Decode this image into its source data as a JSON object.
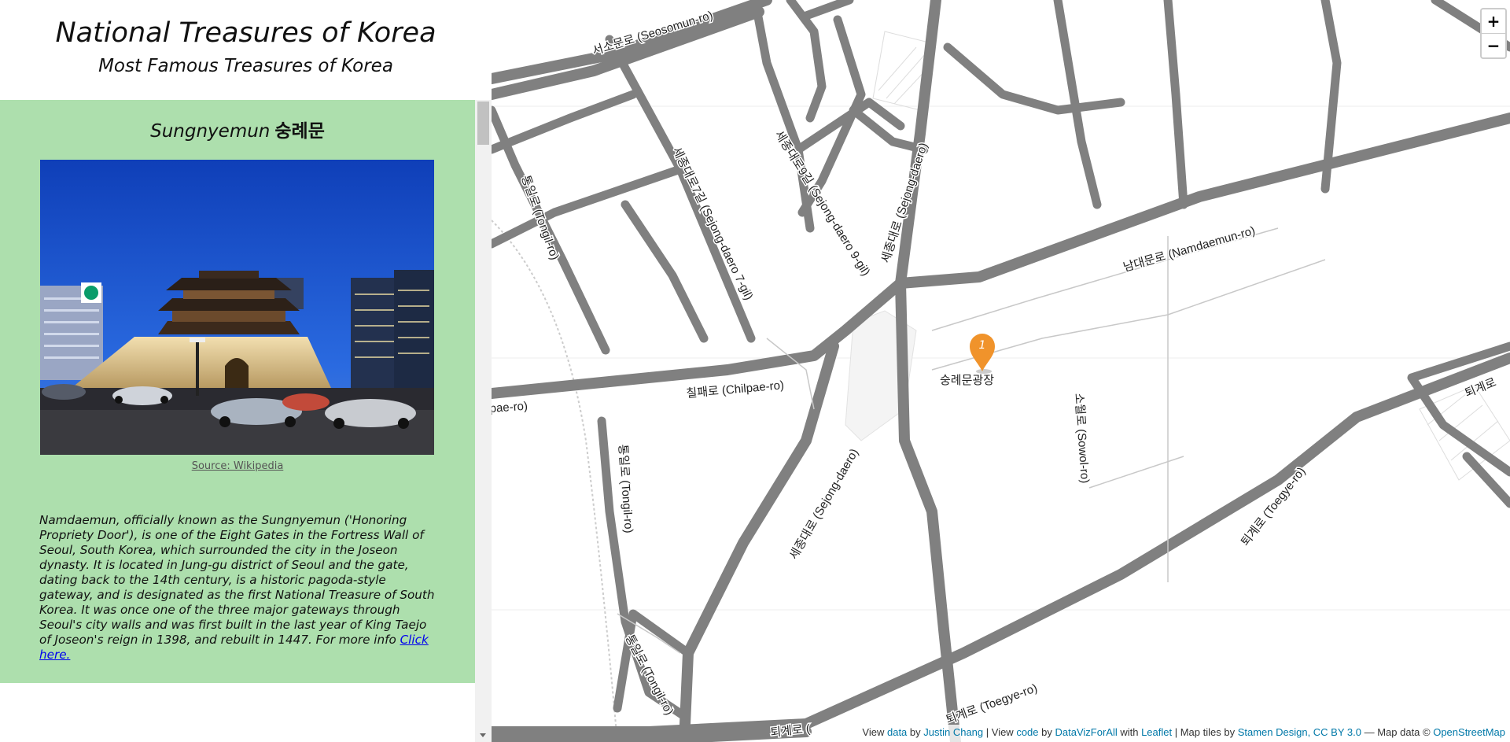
{
  "header": {
    "title": "National Treasures of Korea",
    "subtitle": "Most Famous Treasures of Korea"
  },
  "card": {
    "title_en": "Sungnyemun",
    "title_ko": "숭례문",
    "image_alt": "Sungnyemun gate at dusk",
    "source_label": "Source: Wikipedia",
    "description": "Namdaemun, officially known as the Sungnyemun ('Honoring Propriety Door'), is one of the Eight Gates in the Fortress Wall of Seoul, South Korea, which surrounded the city in the Joseon dynasty. It is located in Jung-gu district of Seoul and the gate, dating back to the 14th century, is a historic pagoda-style gateway, and is designated as the first National Treasure of South Korea. It was once one of the three major gateways through Seoul's city walls and was first built in the last year of King Taejo of Joseon's reign in 1398, and rebuilt in 1447. For more info ",
    "link_label": "Click here."
  },
  "map": {
    "zoom_in": "+",
    "zoom_out": "−",
    "marker_number": "1",
    "labels": {
      "seosomun": "서소문로 (Seosomun-ro)",
      "sejong": "세종대로 (Sejong-daero)",
      "sejong_lower": "세종대로 (Sejong-daero)",
      "sejong7": "세종대로7길 (Sejong-daero 7-gil)",
      "sejong9": "세종대로9길 (Sejong-daero 9-gil)",
      "namdaemun": "남대문로 (Namdaemun-ro)",
      "tongil": "통일로 (Tongil-ro)",
      "tongil2": "통일로 (Tongil-ro)",
      "tongil3": "통일로 (Tongil-ro)",
      "chilpae": "칠패로 (Chilpae-ro)",
      "chilpae_left": "pae-ro)",
      "plaza": "숭례문광장",
      "sowol": "소월로 (Sowol-ro)",
      "toegye": "퇴계로 (Toegye-ro)",
      "toegye2": "퇴계로 (Toegye-ro)",
      "toegye3": "퇴계로 (",
      "toegye_right": "퇴계로"
    },
    "attribution": {
      "view1": "View ",
      "data": "data",
      "by1": " by ",
      "author": "Justin Chang",
      "sep1": " | View ",
      "code": "code",
      "by2": " by ",
      "org": "DataVizForAll",
      "with": " with ",
      "leaflet": "Leaflet",
      "tiles": " | Map tiles by ",
      "stamen": "Stamen Design, CC BY 3.0",
      "mapdata": " — Map data © ",
      "osm": "OpenStreetMap"
    }
  },
  "colors": {
    "card_bg": "#addfad",
    "road": "#808080",
    "marker": "#f0932b",
    "link": "#0000ee",
    "attribution_link": "#0078a8"
  }
}
